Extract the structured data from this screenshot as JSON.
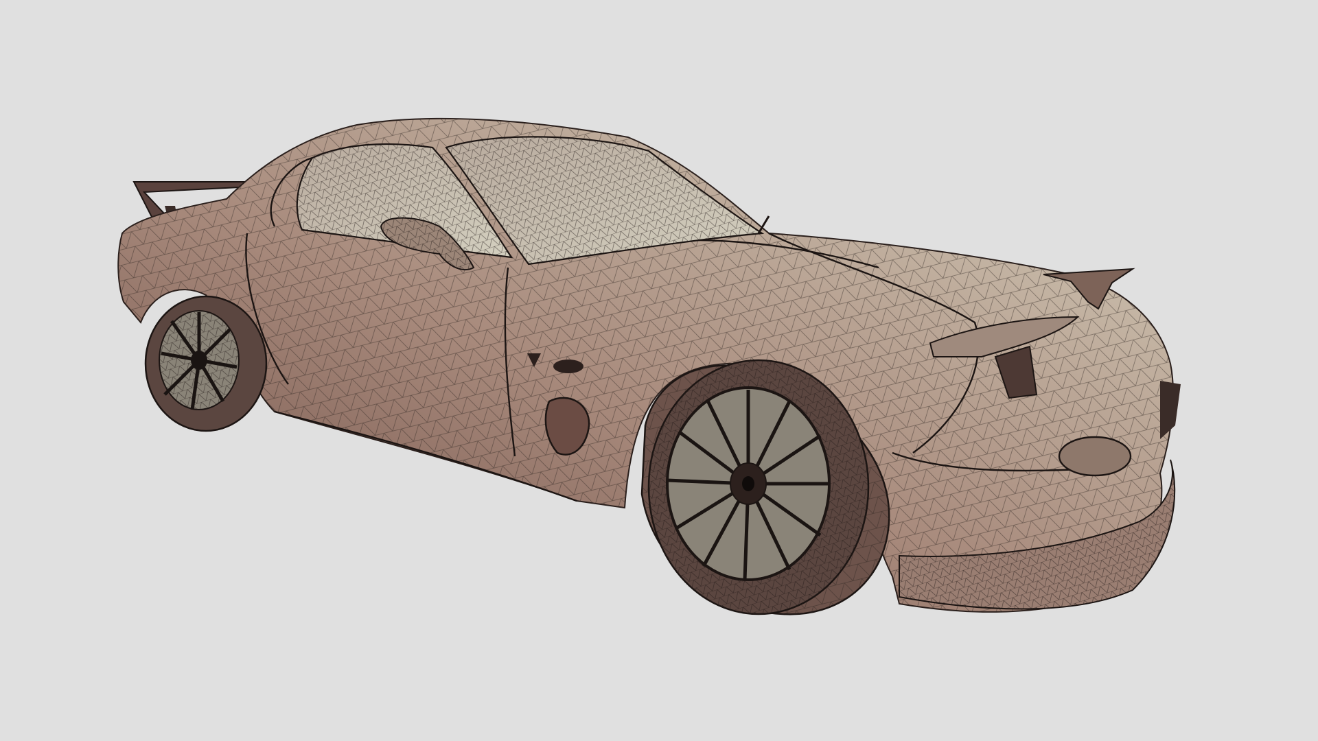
{
  "scene": {
    "subject": "sports-car-wireframe-model",
    "render_mode": "shaded-wireframe",
    "colors": {
      "background": "#e0e0e0",
      "body_dark": "#6e4d45",
      "body_mid": "#a88a7c",
      "body_light": "#d6d0bd",
      "wireframe": "#2b2320",
      "glass": "#c9c5b4",
      "tire": "#5b4640"
    },
    "parts": [
      "body-shell",
      "windshield",
      "side-window",
      "side-mirror",
      "rear-wing",
      "front-canard",
      "front-wheel",
      "rear-wheel",
      "front-bumper-lip",
      "side-vent"
    ]
  }
}
